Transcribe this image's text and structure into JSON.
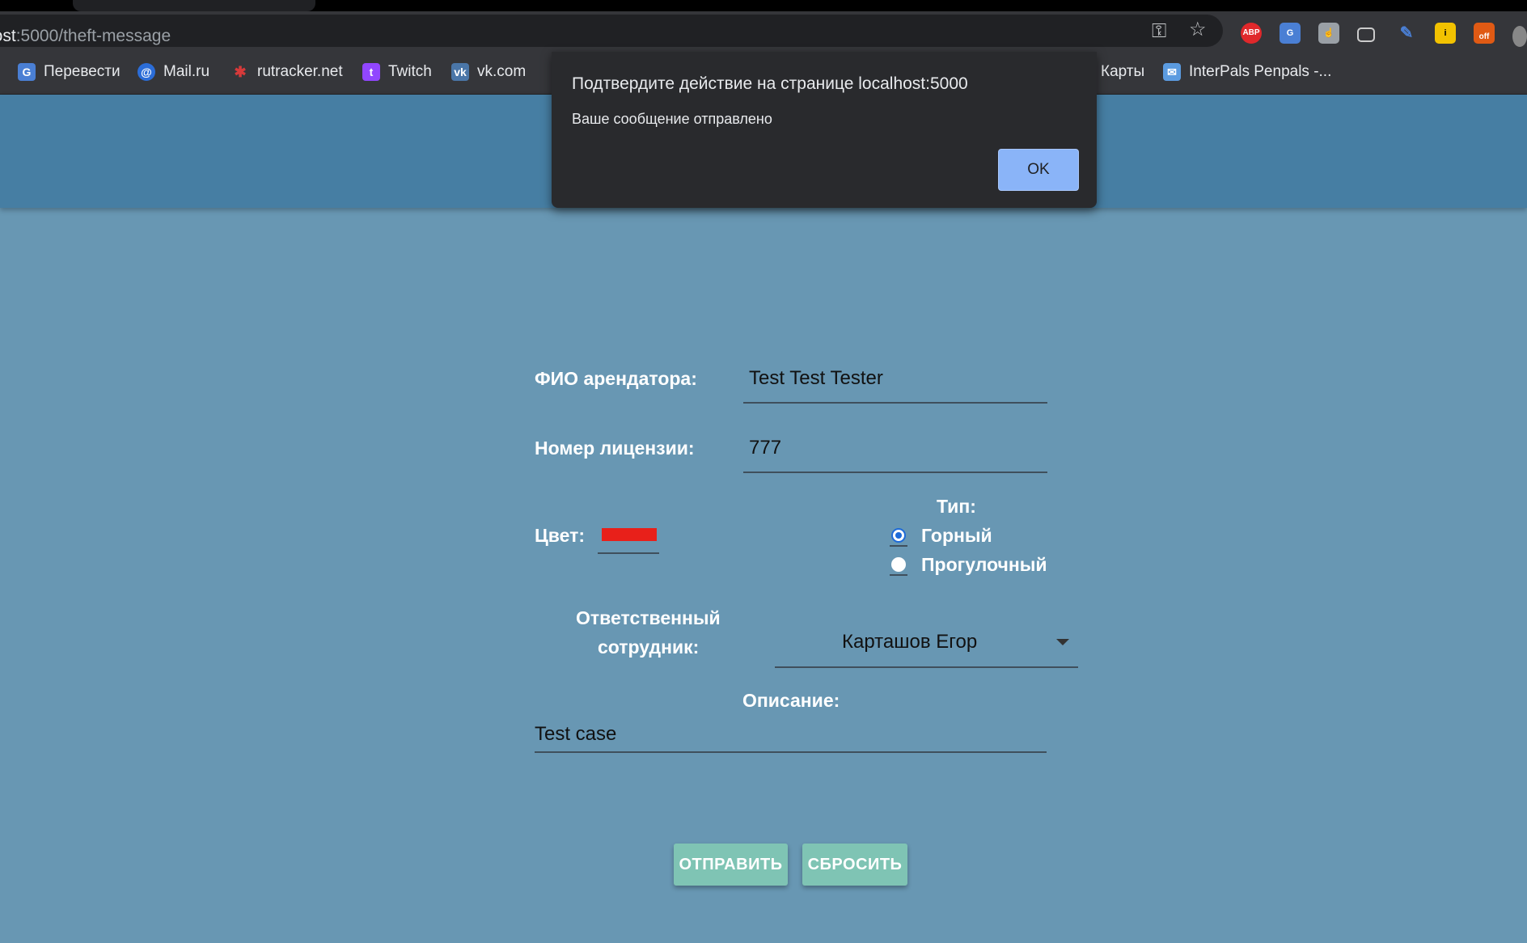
{
  "browser": {
    "url_host": "host",
    "url_rest": ":5000/theft-message",
    "bookmarks": [
      {
        "label": "Перевести",
        "icon": "translate-icon"
      },
      {
        "label": "Mail.ru",
        "icon": "mailru-icon"
      },
      {
        "label": "rutracker.net",
        "icon": "rutracker-icon"
      },
      {
        "label": "Twitch",
        "icon": "twitch-icon"
      },
      {
        "label": "vk.com",
        "icon": "vk-icon"
      },
      {
        "label": "Карты",
        "icon": "maps-icon"
      },
      {
        "label": "InterPals Penpals -...",
        "icon": "interpals-icon"
      }
    ],
    "extensions": {
      "abp": "ABP",
      "off": "off"
    }
  },
  "dialog": {
    "title": "Подтвердите действие на странице localhost:5000",
    "message": "Ваше сообщение отправлено",
    "ok_label": "OK"
  },
  "form": {
    "name_label": "ФИО арендатора:",
    "name_value": "Test Test Tester",
    "license_label": "Номер лицензии:",
    "license_value": "777",
    "color_label": "Цвет:",
    "color_value": "#e8201a",
    "type_label": "Тип:",
    "type_options": [
      {
        "label": "Горный",
        "checked": true
      },
      {
        "label": "Прогулочный",
        "checked": false
      }
    ],
    "employee_label_line1": "Ответственный",
    "employee_label_line2": "сотрудник:",
    "employee_value": "Карташов Егор",
    "description_label": "Описание:",
    "description_value": "Test case",
    "submit_label": "ОТПРАВИТЬ",
    "reset_label": "СБРОСИТЬ"
  },
  "colors": {
    "page_bg": "#6897b3",
    "header_bg": "#467ea3",
    "button_bg": "#7fc4b4",
    "dialog_bg": "#292a2d",
    "ok_button": "#8ab4f8"
  }
}
